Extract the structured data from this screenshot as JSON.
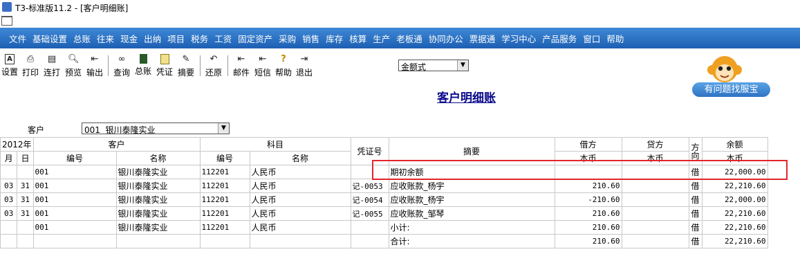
{
  "window": {
    "title": "T3-标准版11.2 - [客户明细账]"
  },
  "menu": [
    "文件",
    "基础设置",
    "总账",
    "往来",
    "现金",
    "出纳",
    "项目",
    "税务",
    "工资",
    "固定资产",
    "采购",
    "销售",
    "库存",
    "核算",
    "生产",
    "老板通",
    "协同办公",
    "票据通",
    "学习中心",
    "产品服务",
    "窗口",
    "帮助"
  ],
  "toolbar": {
    "setup": "设置",
    "print": "打印",
    "batch_print": "连打",
    "preview": "预览",
    "export": "输出",
    "query": "查询",
    "ledger": "总账",
    "voucher": "凭证",
    "summary": "摘要",
    "restore": "还原",
    "mail": "邮件",
    "sms": "短信",
    "help": "帮助",
    "exit": "退出"
  },
  "amount_mode": "金额式",
  "help_bubble": "有问题找服宝",
  "report": {
    "title": "客户明细账",
    "customer_label": "客户",
    "customer_value": "001  银川泰隆实业"
  },
  "table": {
    "year": "2012年",
    "month": "月",
    "day": "日",
    "customer_group": "客户",
    "subject_group": "科目",
    "code": "编号",
    "name": "名称",
    "voucher_no": "凭证号",
    "summary": "摘要",
    "debit": "借方",
    "credit": "贷方",
    "direction": "方向",
    "balance": "余额",
    "currency": "本币",
    "rows": [
      {
        "m": "",
        "d": "",
        "cc": "001",
        "cn": "银川泰隆实业",
        "sc": "112201",
        "sn": "人民币",
        "v": "",
        "s": "期初余额",
        "dr": "",
        "cr": "",
        "dir": "借",
        "bal": "22,000.00"
      },
      {
        "m": "03",
        "d": "31",
        "cc": "001",
        "cn": "银川泰隆实业",
        "sc": "112201",
        "sn": "人民币",
        "v": "记-0053",
        "s": "应收账款_杨宇",
        "dr": "210.60",
        "cr": "",
        "dir": "借",
        "bal": "22,210.60"
      },
      {
        "m": "03",
        "d": "31",
        "cc": "001",
        "cn": "银川泰隆实业",
        "sc": "112201",
        "sn": "人民币",
        "v": "记-0054",
        "s": "应收账款_杨宇",
        "dr": "-210.60",
        "cr": "",
        "dir": "借",
        "bal": "22,000.00"
      },
      {
        "m": "03",
        "d": "31",
        "cc": "001",
        "cn": "银川泰隆实业",
        "sc": "112201",
        "sn": "人民币",
        "v": "记-0055",
        "s": "应收账款_邹琴",
        "dr": "210.60",
        "cr": "",
        "dir": "借",
        "bal": "22,210.60"
      },
      {
        "m": "",
        "d": "",
        "cc": "001",
        "cn": "银川泰隆实业",
        "sc": "112201",
        "sn": "人民币",
        "v": "",
        "s": "小计:",
        "dr": "210.60",
        "cr": "",
        "dir": "借",
        "bal": "22,210.60"
      },
      {
        "m": "",
        "d": "",
        "cc": "",
        "cn": "",
        "sc": "",
        "sn": "",
        "v": "",
        "s": "合计:",
        "dr": "210.60",
        "cr": "",
        "dir": "借",
        "bal": "22,210.60"
      }
    ]
  }
}
